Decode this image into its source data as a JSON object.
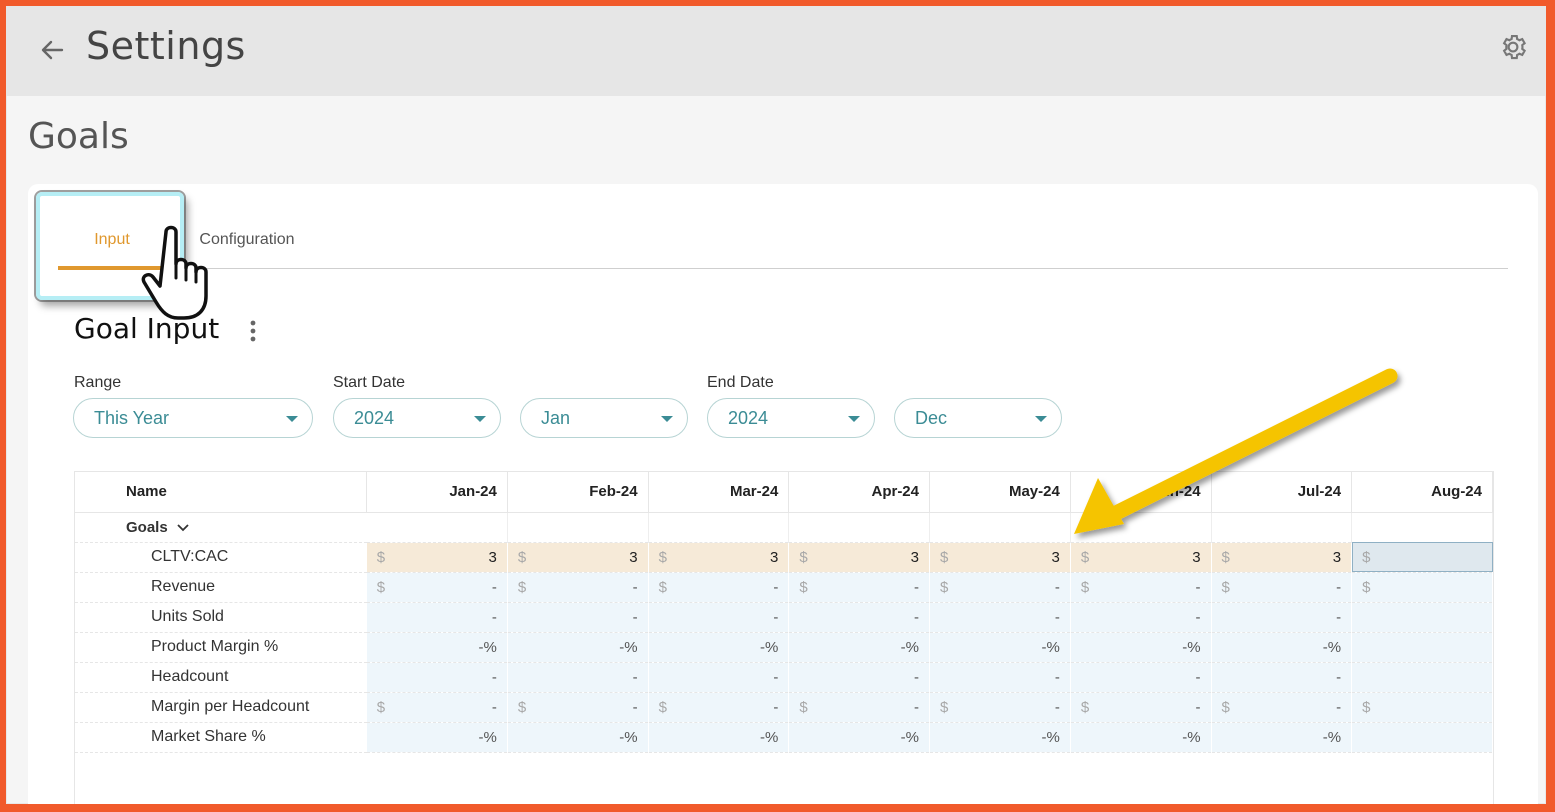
{
  "topbar": {
    "title": "Settings",
    "back_icon": "arrow-left-icon",
    "settings_icon": "gear-icon"
  },
  "page": {
    "title": "Goals"
  },
  "tabs": [
    {
      "label": "Input",
      "active": true
    },
    {
      "label": "Configuration",
      "active": false
    }
  ],
  "section": {
    "title": "Goal Input",
    "menu_icon": "kebab-icon"
  },
  "filters": {
    "range": {
      "label": "Range",
      "value": "This Year"
    },
    "start_date": {
      "label": "Start Date",
      "year": "2024",
      "month": "Jan"
    },
    "end_date": {
      "label": "End Date",
      "year": "2024",
      "month": "Dec"
    }
  },
  "table": {
    "name_header": "Name",
    "columns": [
      "Jan-24",
      "Feb-24",
      "Mar-24",
      "Apr-24",
      "May-24",
      "Jun-24",
      "Jul-24",
      "Aug-24"
    ],
    "group": {
      "label": "Goals",
      "icon": "chevron-down-icon"
    },
    "currency_symbol": "$",
    "rows": [
      {
        "name": "CLTV:CAC",
        "currency": true,
        "highlight": true,
        "values": [
          "3",
          "3",
          "3",
          "3",
          "3",
          "3",
          "3",
          ""
        ]
      },
      {
        "name": "Revenue",
        "currency": true,
        "highlight": false,
        "values": [
          "-",
          "-",
          "-",
          "-",
          "-",
          "-",
          "-",
          ""
        ]
      },
      {
        "name": "Units Sold",
        "currency": false,
        "highlight": false,
        "values": [
          "-",
          "-",
          "-",
          "-",
          "-",
          "-",
          "-",
          ""
        ]
      },
      {
        "name": "Product Margin %",
        "currency": false,
        "highlight": false,
        "values": [
          "-%",
          "-%",
          "-%",
          "-%",
          "-%",
          "-%",
          "-%",
          ""
        ]
      },
      {
        "name": "Headcount",
        "currency": false,
        "highlight": false,
        "values": [
          "-",
          "-",
          "-",
          "-",
          "-",
          "-",
          "-",
          ""
        ]
      },
      {
        "name": "Margin per Headcount",
        "currency": true,
        "highlight": false,
        "values": [
          "-",
          "-",
          "-",
          "-",
          "-",
          "-",
          "-",
          ""
        ]
      },
      {
        "name": "Market Share %",
        "currency": false,
        "highlight": false,
        "values": [
          "-%",
          "-%",
          "-%",
          "-%",
          "-%",
          "-%",
          "-%",
          ""
        ]
      }
    ]
  },
  "annotation": {
    "arrow_color": "#f5c400",
    "highlight_color": "#b6eef5"
  }
}
